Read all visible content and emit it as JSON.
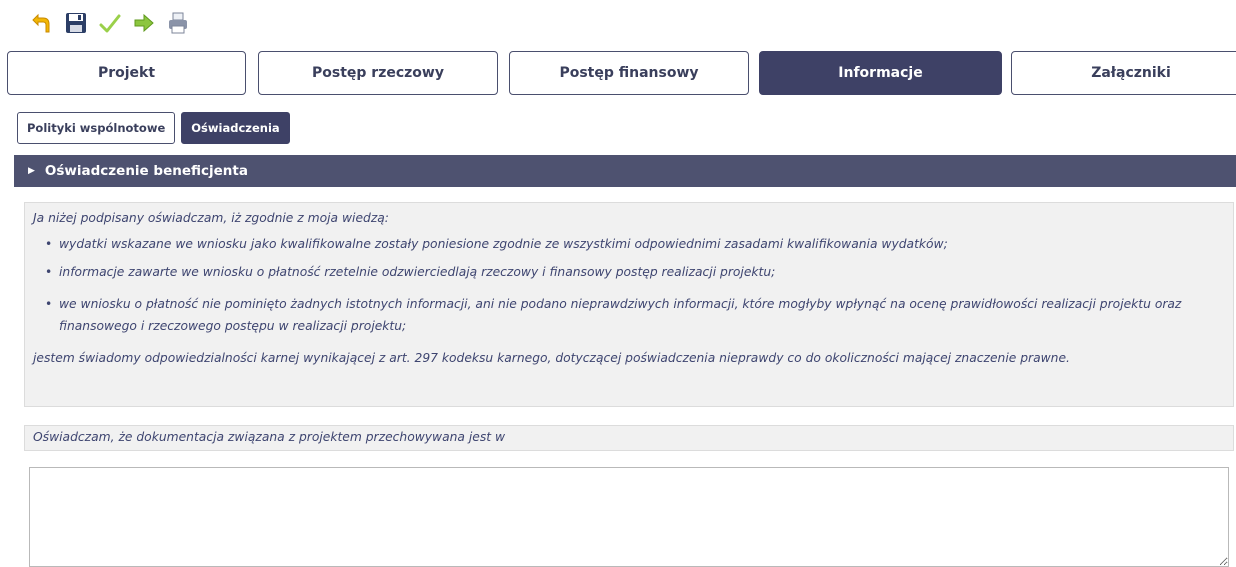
{
  "toolbar": {
    "items": [
      {
        "name": "undo-icon",
        "color": "#e8a800"
      },
      {
        "name": "save-icon",
        "color": "#2c3e66"
      },
      {
        "name": "checkmark-icon",
        "color": "#9ad04a"
      },
      {
        "name": "submit-arrow-icon",
        "color": "#8cc63f"
      },
      {
        "name": "print-icon",
        "color": "#8a93a8"
      }
    ]
  },
  "main_tabs": [
    {
      "label": "Projekt",
      "active": false
    },
    {
      "label": "Postęp rzeczowy",
      "active": false
    },
    {
      "label": "Postęp finansowy",
      "active": false
    },
    {
      "label": "Informacje",
      "active": true
    },
    {
      "label": "Załączniki",
      "active": false
    }
  ],
  "sub_tabs": [
    {
      "label": "Polityki wspólnotowe",
      "active": false
    },
    {
      "label": "Oświadczenia",
      "active": true
    }
  ],
  "section": {
    "title": "Oświadczenie beneficjenta",
    "expanded": true
  },
  "declaration": {
    "intro": "Ja niżej podpisany oświadczam, iż zgodnie z moja wiedzą:",
    "bullets": [
      "wydatki wskazane we wniosku jako kwalifikowalne zostały poniesione zgodnie ze wszystkimi odpowiednimi zasadami kwalifikowania wydatków;",
      "informacje zawarte we wniosku o płatność rzetelnie odzwierciedlają rzeczowy i finansowy postęp realizacji projektu;",
      "we wniosku o płatność nie pominięto żadnych istotnych informacji, ani nie podano nieprawdziwych informacji, które mogłyby wpłynąć na ocenę prawidłowości realizacji projektu oraz finansowego i rzeczowego postępu w realizacji projektu;"
    ],
    "closing": "jestem świadomy odpowiedzialności karnej wynikającej z art. 297 kodeksu karnego, dotyczącej poświadczenia nieprawdy co do okoliczności mającej znaczenie prawne."
  },
  "storage": {
    "label": "Oświadczam, że dokumentacja związana z projektem przechowywana jest w",
    "value": ""
  },
  "colors": {
    "accent": "#3e4166",
    "section_header": "#4e5270",
    "text_italic": "#3e4570",
    "panel_bg": "#f1f1f1"
  }
}
